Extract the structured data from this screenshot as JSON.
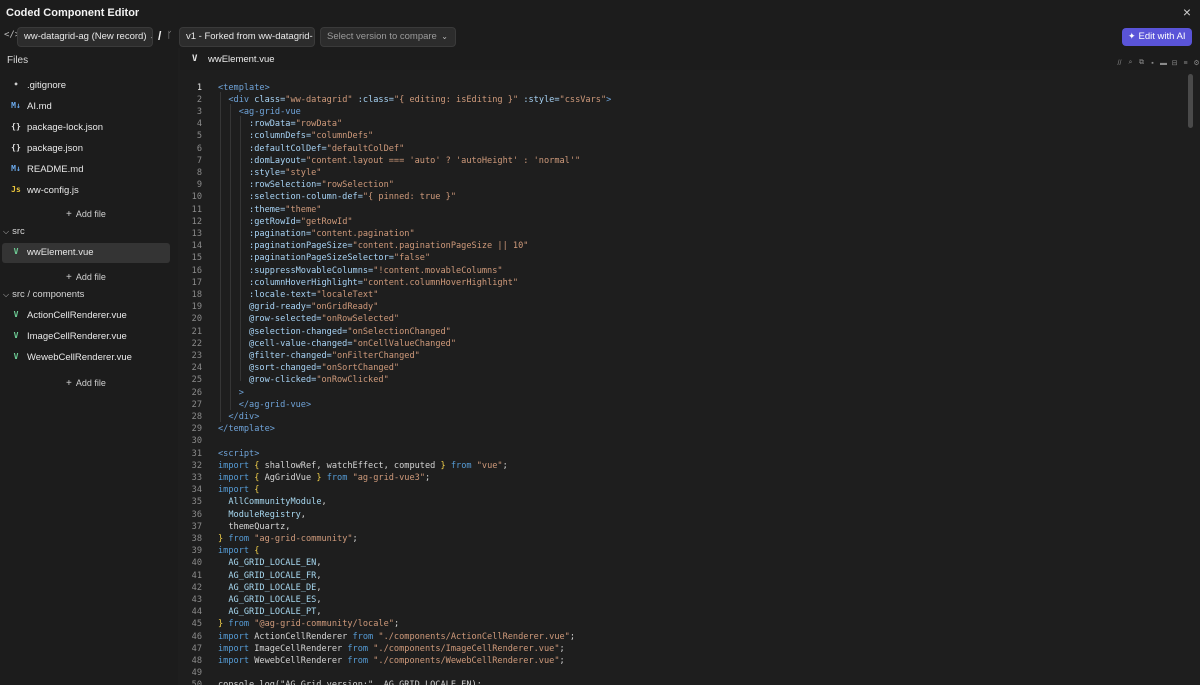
{
  "window": {
    "title": "Coded Component Editor",
    "close": "×"
  },
  "toolbar": {
    "code_icon": "</>",
    "record_select": "ww-datagrid-ag (New record)",
    "separator": "/",
    "branch_icon": "ᚴ",
    "version_select": "v1 - Forked from ww-datagrid-",
    "compare_placeholder": "Select version to compare",
    "ai_button": "Edit with AI"
  },
  "sidebar": {
    "files_label": "Files",
    "root_files": [
      {
        "icon": "•",
        "name": ".gitignore"
      },
      {
        "icon": "M↓",
        "name": "AI.md"
      },
      {
        "icon": "{}",
        "name": "package-lock.json"
      },
      {
        "icon": "{}",
        "name": "package.json"
      },
      {
        "icon": "M↓",
        "name": "README.md"
      },
      {
        "icon": "Js",
        "name": "ww-config.js"
      }
    ],
    "add_file": "Add file",
    "folders": [
      {
        "label": "src",
        "files": [
          {
            "icon": "V",
            "name": "wwElement.vue"
          }
        ]
      },
      {
        "label": "src / components",
        "files": [
          {
            "icon": "V",
            "name": "ActionCellRenderer.vue"
          },
          {
            "icon": "V",
            "name": "ImageCellRenderer.vue"
          },
          {
            "icon": "V",
            "name": "WewebCellRenderer.vue"
          }
        ]
      }
    ]
  },
  "editor": {
    "tab_icon": "V",
    "tab_name": "wwElement.vue",
    "tools": [
      "//",
      "⌕",
      "⧉",
      "▪",
      "▬",
      "⊟",
      "≡",
      "⚙"
    ],
    "code_lines": [
      [
        [
          "t-tag",
          "<template>"
        ]
      ],
      [
        [
          "t-plain",
          "  "
        ],
        [
          "t-tag",
          "<div "
        ],
        [
          "t-attr",
          "class="
        ],
        [
          "t-str",
          "\"ww-datagrid\""
        ],
        [
          "t-attr",
          " :class="
        ],
        [
          "t-str",
          "\"{ editing: isEditing }\""
        ],
        [
          "t-attr",
          " :style="
        ],
        [
          "t-str",
          "\"cssVars\""
        ],
        [
          "t-tag",
          ">"
        ]
      ],
      [
        [
          "t-plain",
          "    "
        ],
        [
          "t-tag",
          "<ag-grid-vue"
        ]
      ],
      [
        [
          "t-plain",
          "      "
        ],
        [
          "t-attr",
          ":rowData="
        ],
        [
          "t-str",
          "\"rowData\""
        ]
      ],
      [
        [
          "t-plain",
          "      "
        ],
        [
          "t-attr",
          ":columnDefs="
        ],
        [
          "t-str",
          "\"columnDefs\""
        ]
      ],
      [
        [
          "t-plain",
          "      "
        ],
        [
          "t-attr",
          ":defaultColDef="
        ],
        [
          "t-str",
          "\"defaultColDef\""
        ]
      ],
      [
        [
          "t-plain",
          "      "
        ],
        [
          "t-attr",
          ":domLayout="
        ],
        [
          "t-str",
          "\"content.layout === 'auto' ? 'autoHeight' : 'normal'\""
        ]
      ],
      [
        [
          "t-plain",
          "      "
        ],
        [
          "t-attr",
          ":style="
        ],
        [
          "t-str",
          "\"style\""
        ]
      ],
      [
        [
          "t-plain",
          "      "
        ],
        [
          "t-attr",
          ":rowSelection="
        ],
        [
          "t-str",
          "\"rowSelection\""
        ]
      ],
      [
        [
          "t-plain",
          "      "
        ],
        [
          "t-attr",
          ":selection-column-def="
        ],
        [
          "t-str",
          "\"{ pinned: true }\""
        ]
      ],
      [
        [
          "t-plain",
          "      "
        ],
        [
          "t-attr",
          ":theme="
        ],
        [
          "t-str",
          "\"theme\""
        ]
      ],
      [
        [
          "t-plain",
          "      "
        ],
        [
          "t-attr",
          ":getRowId="
        ],
        [
          "t-str",
          "\"getRowId\""
        ]
      ],
      [
        [
          "t-plain",
          "      "
        ],
        [
          "t-attr",
          ":pagination="
        ],
        [
          "t-str",
          "\"content.pagination\""
        ]
      ],
      [
        [
          "t-plain",
          "      "
        ],
        [
          "t-attr",
          ":paginationPageSize="
        ],
        [
          "t-str",
          "\"content.paginationPageSize || 10\""
        ]
      ],
      [
        [
          "t-plain",
          "      "
        ],
        [
          "t-attr",
          ":paginationPageSizeSelector="
        ],
        [
          "t-str",
          "\"false\""
        ]
      ],
      [
        [
          "t-plain",
          "      "
        ],
        [
          "t-attr",
          ":suppressMovableColumns="
        ],
        [
          "t-str",
          "\"!content.movableColumns\""
        ]
      ],
      [
        [
          "t-plain",
          "      "
        ],
        [
          "t-attr",
          ":columnHoverHighlight="
        ],
        [
          "t-str",
          "\"content.columnHoverHighlight\""
        ]
      ],
      [
        [
          "t-plain",
          "      "
        ],
        [
          "t-attr",
          ":locale-text="
        ],
        [
          "t-str",
          "\"localeText\""
        ]
      ],
      [
        [
          "t-plain",
          "      "
        ],
        [
          "t-attr",
          "@grid-ready="
        ],
        [
          "t-str",
          "\"onGridReady\""
        ]
      ],
      [
        [
          "t-plain",
          "      "
        ],
        [
          "t-attr",
          "@row-selected="
        ],
        [
          "t-str",
          "\"onRowSelected\""
        ]
      ],
      [
        [
          "t-plain",
          "      "
        ],
        [
          "t-attr",
          "@selection-changed="
        ],
        [
          "t-str",
          "\"onSelectionChanged\""
        ]
      ],
      [
        [
          "t-plain",
          "      "
        ],
        [
          "t-attr",
          "@cell-value-changed="
        ],
        [
          "t-str",
          "\"onCellValueChanged\""
        ]
      ],
      [
        [
          "t-plain",
          "      "
        ],
        [
          "t-attr",
          "@filter-changed="
        ],
        [
          "t-str",
          "\"onFilterChanged\""
        ]
      ],
      [
        [
          "t-plain",
          "      "
        ],
        [
          "t-attr",
          "@sort-changed="
        ],
        [
          "t-str",
          "\"onSortChanged\""
        ]
      ],
      [
        [
          "t-plain",
          "      "
        ],
        [
          "t-attr",
          "@row-clicked="
        ],
        [
          "t-str",
          "\"onRowClicked\""
        ]
      ],
      [
        [
          "t-plain",
          "    "
        ],
        [
          "t-tag",
          ">"
        ]
      ],
      [
        [
          "t-plain",
          "    "
        ],
        [
          "t-tag",
          "</ag-grid-vue>"
        ]
      ],
      [
        [
          "t-plain",
          "  "
        ],
        [
          "t-tag",
          "</div>"
        ]
      ],
      [
        [
          "t-tag",
          "</template>"
        ]
      ],
      [],
      [
        [
          "t-tag",
          "<script>"
        ]
      ],
      [
        [
          "t-kw",
          "import "
        ],
        [
          "t-br",
          "{ "
        ],
        [
          "t-plain",
          "shallowRef, watchEffect, computed "
        ],
        [
          "t-br",
          "}"
        ],
        [
          "t-kw",
          " from "
        ],
        [
          "t-str",
          "\"vue\""
        ],
        [
          "t-plain",
          ";"
        ]
      ],
      [
        [
          "t-kw",
          "import "
        ],
        [
          "t-br",
          "{ "
        ],
        [
          "t-plain",
          "AgGridVue "
        ],
        [
          "t-br",
          "}"
        ],
        [
          "t-kw",
          " from "
        ],
        [
          "t-str",
          "\"ag-grid-vue3\""
        ],
        [
          "t-plain",
          ";"
        ]
      ],
      [
        [
          "t-kw",
          "import "
        ],
        [
          "t-br",
          "{"
        ]
      ],
      [
        [
          "t-plain",
          "  "
        ],
        [
          "t-var",
          "AllCommunityModule"
        ],
        [
          "t-plain",
          ","
        ]
      ],
      [
        [
          "t-plain",
          "  "
        ],
        [
          "t-var",
          "ModuleRegistry"
        ],
        [
          "t-plain",
          ","
        ]
      ],
      [
        [
          "t-plain",
          "  themeQuartz,"
        ]
      ],
      [
        [
          "t-br",
          "}"
        ],
        [
          "t-kw",
          " from "
        ],
        [
          "t-str",
          "\"ag-grid-community\""
        ],
        [
          "t-plain",
          ";"
        ]
      ],
      [
        [
          "t-kw",
          "import "
        ],
        [
          "t-br",
          "{"
        ]
      ],
      [
        [
          "t-plain",
          "  "
        ],
        [
          "t-var",
          "AG_GRID_LOCALE_EN"
        ],
        [
          "t-plain",
          ","
        ]
      ],
      [
        [
          "t-plain",
          "  "
        ],
        [
          "t-var",
          "AG_GRID_LOCALE_FR"
        ],
        [
          "t-plain",
          ","
        ]
      ],
      [
        [
          "t-plain",
          "  "
        ],
        [
          "t-var",
          "AG_GRID_LOCALE_DE"
        ],
        [
          "t-plain",
          ","
        ]
      ],
      [
        [
          "t-plain",
          "  "
        ],
        [
          "t-var",
          "AG_GRID_LOCALE_ES"
        ],
        [
          "t-plain",
          ","
        ]
      ],
      [
        [
          "t-plain",
          "  "
        ],
        [
          "t-var",
          "AG_GRID_LOCALE_PT"
        ],
        [
          "t-plain",
          ","
        ]
      ],
      [
        [
          "t-br",
          "}"
        ],
        [
          "t-kw",
          " from "
        ],
        [
          "t-str",
          "\"@ag-grid-community/locale\""
        ],
        [
          "t-plain",
          ";"
        ]
      ],
      [
        [
          "t-kw",
          "import "
        ],
        [
          "t-plain",
          "ActionCellRenderer "
        ],
        [
          "t-kw",
          "from "
        ],
        [
          "t-str",
          "\"./components/ActionCellRenderer.vue\""
        ],
        [
          "t-plain",
          ";"
        ]
      ],
      [
        [
          "t-kw",
          "import "
        ],
        [
          "t-plain",
          "ImageCellRenderer "
        ],
        [
          "t-kw",
          "from "
        ],
        [
          "t-str",
          "\"./components/ImageCellRenderer.vue\""
        ],
        [
          "t-plain",
          ";"
        ]
      ],
      [
        [
          "t-kw",
          "import "
        ],
        [
          "t-plain",
          "WewebCellRenderer "
        ],
        [
          "t-kw",
          "from "
        ],
        [
          "t-str",
          "\"./components/WewebCellRenderer.vue\""
        ],
        [
          "t-plain",
          ";"
        ]
      ],
      [],
      [
        [
          "t-plain",
          "console.log(\"AG Grid version:\", AG_GRID_LOCALE_EN);"
        ]
      ]
    ]
  }
}
